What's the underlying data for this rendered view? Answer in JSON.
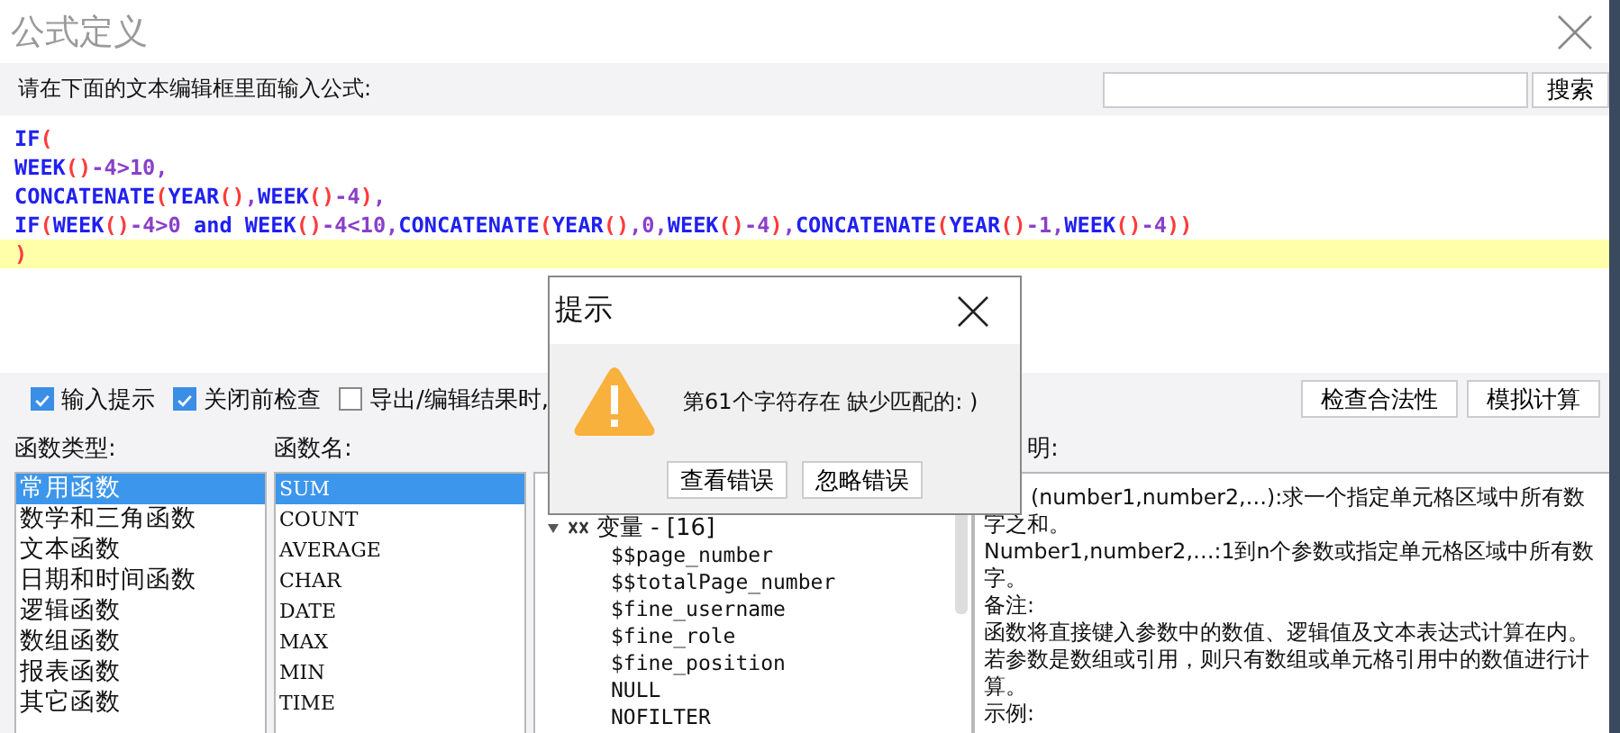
{
  "window": {
    "title": "公式定义"
  },
  "instruction": "请在下面的文本编辑框里面输入公式:",
  "search": {
    "button": "搜索"
  },
  "editor": {
    "lines": [
      {
        "text": "IF(",
        "highlighted": false
      },
      {
        "text": "WEEK()-4>10,",
        "highlighted": false
      },
      {
        "text": "CONCATENATE(YEAR(),WEEK()-4),",
        "highlighted": false
      },
      {
        "text": "IF(WEEK()-4>0 and WEEK()-4<10,CONCATENATE(YEAR(),0,WEEK()-4),CONCATENATE(YEAR()-1,WEEK()-4))",
        "highlighted": false
      },
      {
        "text": ")",
        "highlighted": true
      }
    ]
  },
  "options": [
    {
      "label": "输入提示",
      "checked": true
    },
    {
      "label": "关闭前检查",
      "checked": true
    },
    {
      "label": "导出/编辑结果时,",
      "checked": false
    }
  ],
  "actions": [
    "检查合法性",
    "模拟计算"
  ],
  "function_types": {
    "label": "函数类型:",
    "items": [
      {
        "label": "常用函数",
        "selected": true
      },
      {
        "label": "数学和三角函数",
        "selected": false
      },
      {
        "label": "文本函数",
        "selected": false
      },
      {
        "label": "日期和时间函数",
        "selected": false
      },
      {
        "label": "逻辑函数",
        "selected": false
      },
      {
        "label": "数组函数",
        "selected": false
      },
      {
        "label": "报表函数",
        "selected": false
      },
      {
        "label": "其它函数",
        "selected": false
      }
    ]
  },
  "function_names": {
    "label": "函数名:",
    "items": [
      {
        "label": "SUM",
        "selected": true
      },
      {
        "label": "COUNT",
        "selected": false
      },
      {
        "label": "AVERAGE",
        "selected": false
      },
      {
        "label": "CHAR",
        "selected": false
      },
      {
        "label": "DATE",
        "selected": false
      },
      {
        "label": "MAX",
        "selected": false
      },
      {
        "label": "MIN",
        "selected": false
      },
      {
        "label": "TIME",
        "selected": false
      }
    ]
  },
  "variables": {
    "tree": [
      {
        "label": "变量 - [16]",
        "expanded": true,
        "children": [
          {
            "label": "$$page_number"
          },
          {
            "label": "$$totalPage_number"
          },
          {
            "label": "$fine_username"
          },
          {
            "label": "$fine_role"
          },
          {
            "label": "$fine_position"
          },
          {
            "label": "NULL"
          },
          {
            "label": "NOFILTER"
          }
        ]
      }
    ]
  },
  "description": {
    "label": "明:",
    "paragraphs": [
      "(number1,number2,…):求一个指定单元格区域中所有数字之和。",
      "Number1,number2,…:1到n个参数或指定单元格区域中所有数字。",
      "备注:",
      "函数将直接键入参数中的数值、逻辑值及文本表达式计算在内。若参数是数组或引用，则只有数组或单元格引用中的数值进行计算。",
      "示例:"
    ]
  },
  "dialog": {
    "title": "提示",
    "message": "第61个字符存在 缺少匹配的: )",
    "buttons": [
      "查看错误",
      "忽略错误"
    ]
  }
}
